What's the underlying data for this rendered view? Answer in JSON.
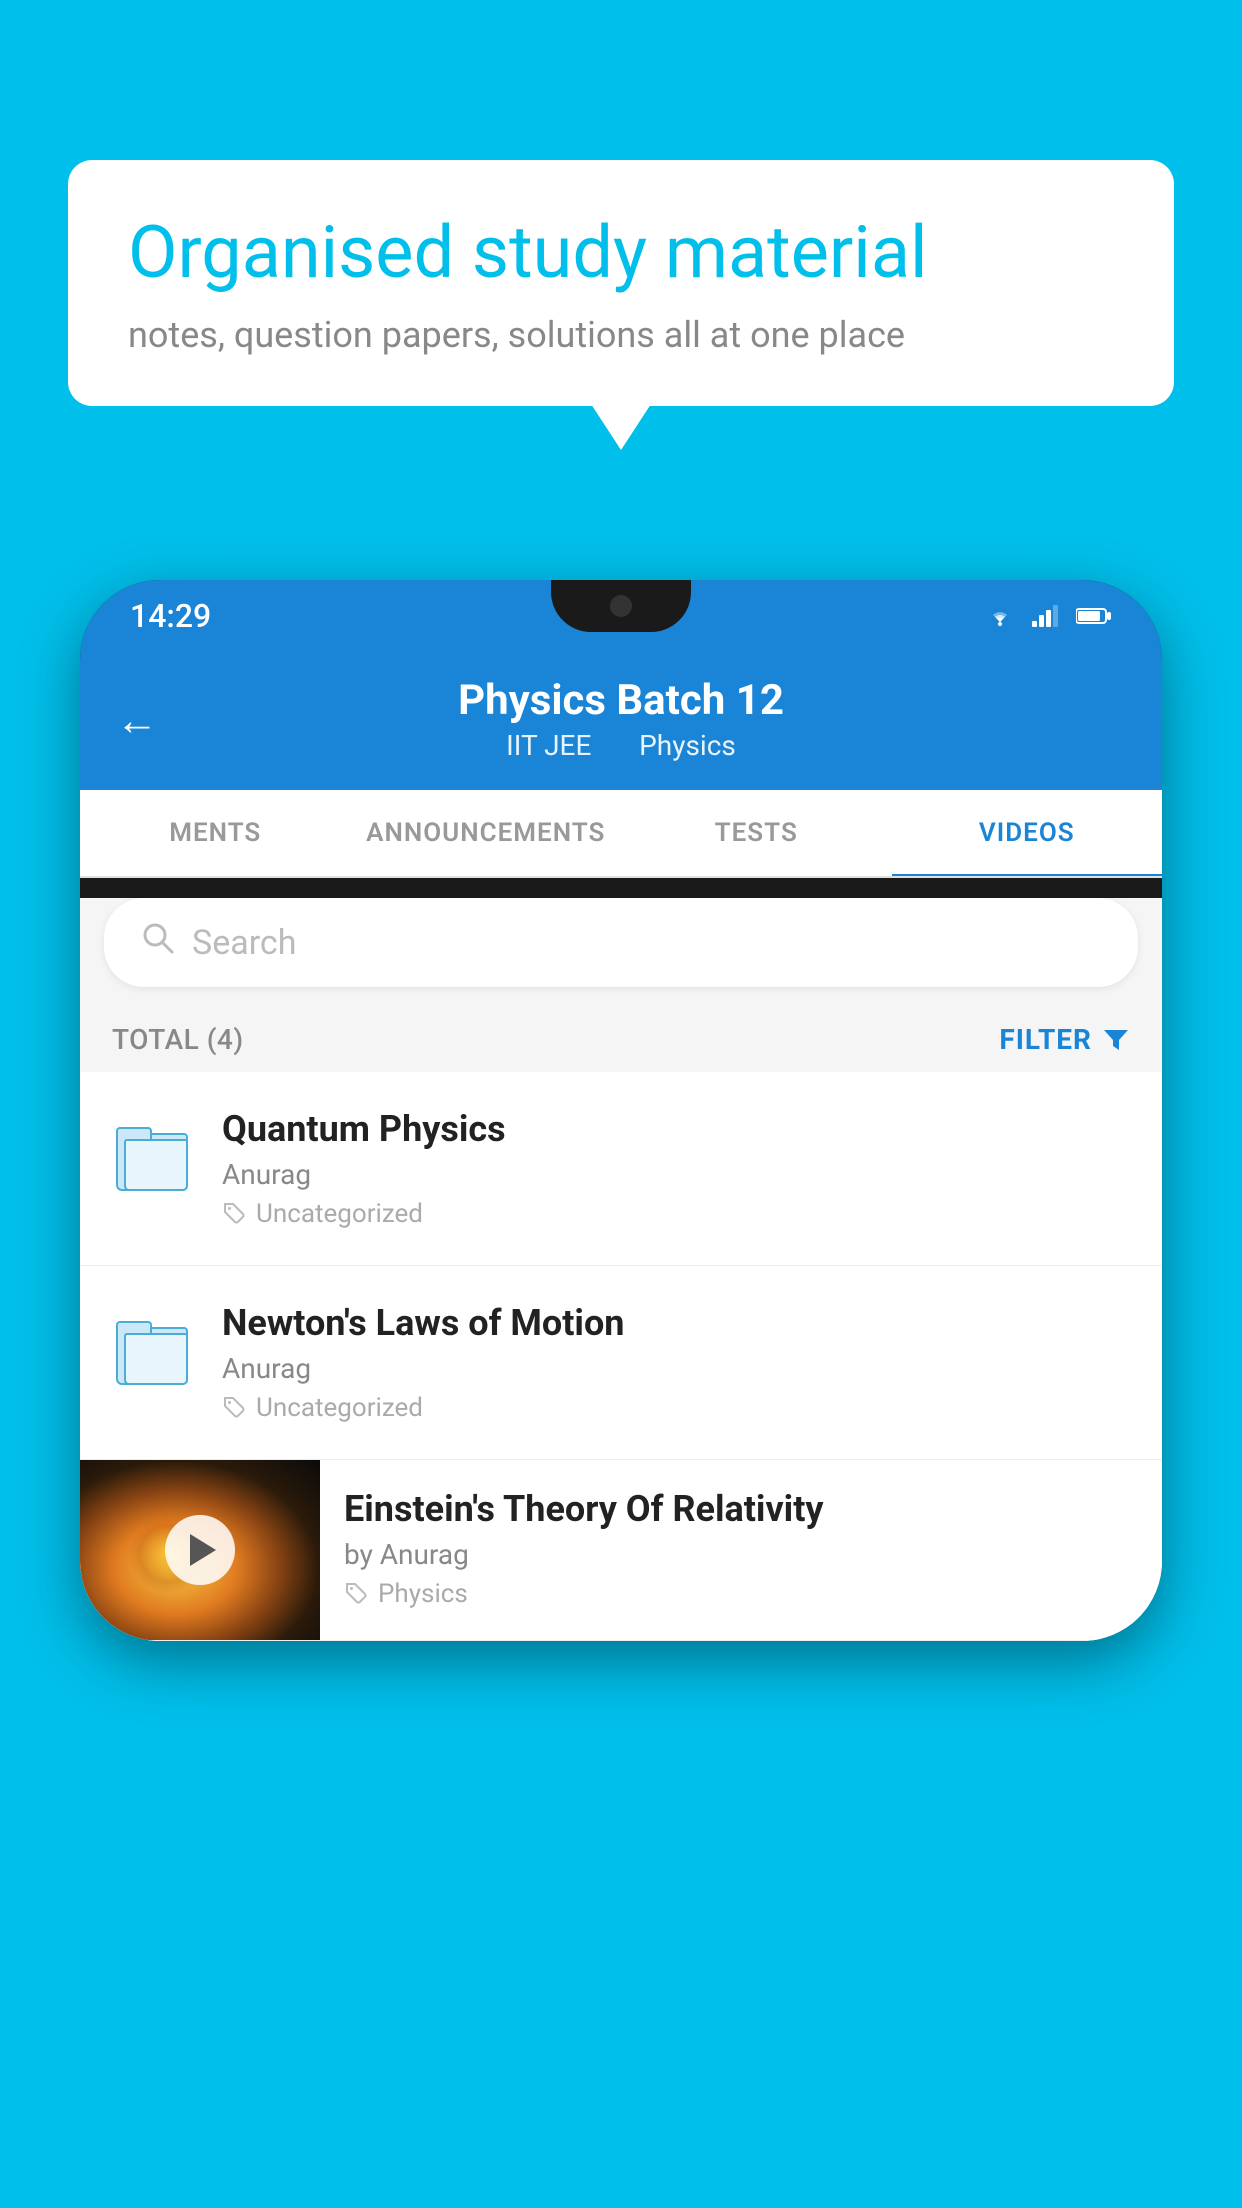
{
  "background_color": "#00BFEA",
  "speech_bubble": {
    "title": "Organised study material",
    "subtitle": "notes, question papers, solutions all at one place"
  },
  "phone": {
    "status_bar": {
      "time": "14:29"
    },
    "header": {
      "title": "Physics Batch 12",
      "subtitle_left": "IIT JEE",
      "subtitle_right": "Physics",
      "back_label": "←"
    },
    "tabs": [
      {
        "label": "MENTS",
        "active": false
      },
      {
        "label": "ANNOUNCEMENTS",
        "active": false
      },
      {
        "label": "TESTS",
        "active": false
      },
      {
        "label": "VIDEOS",
        "active": true
      }
    ],
    "search": {
      "placeholder": "Search"
    },
    "filter_row": {
      "total_label": "TOTAL (4)",
      "filter_label": "FILTER"
    },
    "videos": [
      {
        "id": 1,
        "title": "Quantum Physics",
        "author": "Anurag",
        "tag": "Uncategorized",
        "type": "folder"
      },
      {
        "id": 2,
        "title": "Newton's Laws of Motion",
        "author": "Anurag",
        "tag": "Uncategorized",
        "type": "folder"
      },
      {
        "id": 3,
        "title": "Einstein's Theory Of Relativity",
        "author": "by Anurag",
        "tag": "Physics",
        "type": "video"
      }
    ]
  }
}
